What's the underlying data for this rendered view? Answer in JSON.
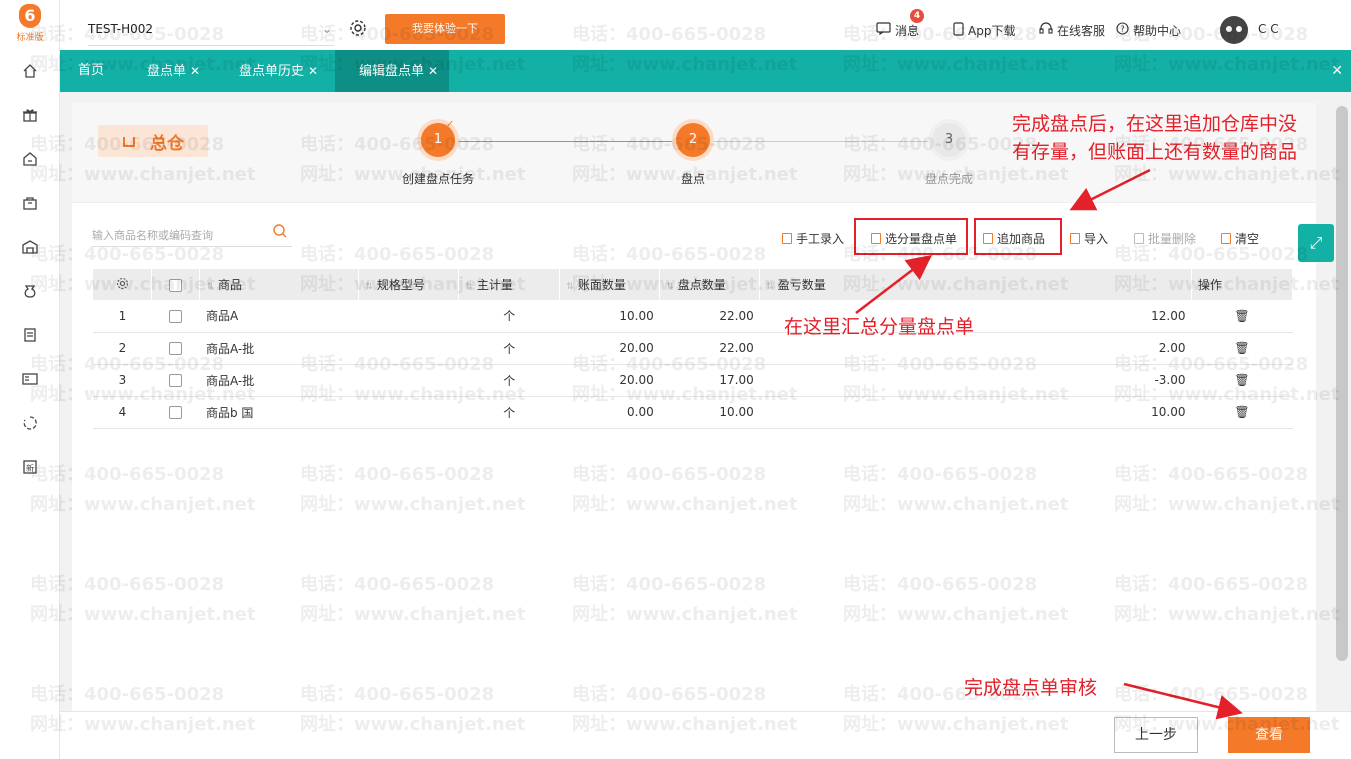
{
  "brand": {
    "logo_char": "6",
    "edition": "标准版",
    "accent": "#f47a2a",
    "teal": "#13b0a5"
  },
  "topbar": {
    "account": "TEST-H002",
    "try_button": "我要体验一下",
    "messages_label": "消息",
    "messages_badge": "4",
    "app_download": "App下载",
    "online_service": "在线客服",
    "help_center": "帮助中心",
    "user_name": "C C"
  },
  "tabs": [
    {
      "label": "首页"
    },
    {
      "label": "盘点单"
    },
    {
      "label": "盘点单历史"
    },
    {
      "label": "编辑盘点单"
    }
  ],
  "warehouse": "总仓",
  "steps": [
    {
      "num": "1",
      "label": "创建盘点任务"
    },
    {
      "num": "2",
      "label": "盘点"
    },
    {
      "num": "3",
      "label": "盘点完成"
    }
  ],
  "search": {
    "placeholder": "输入商品名称或编码查询"
  },
  "toolbar": {
    "manual_entry": "手工录入",
    "select_sub": "选分量盘点单",
    "add_goods": "追加商品",
    "import": "导入",
    "batch_delete": "批量删除",
    "clear": "清空"
  },
  "table": {
    "headers": {
      "goods": "商品",
      "spec": "规格型号",
      "unit": "主计量",
      "book_qty": "账面数量",
      "count_qty": "盘点数量",
      "diff_qty": "盈亏数量",
      "action": "操作"
    },
    "rows": [
      {
        "idx": "1",
        "goods": "商品A",
        "unit": "个",
        "book": "10.00",
        "count": "22.00",
        "diff": "12.00"
      },
      {
        "idx": "2",
        "goods": "商品A-批",
        "unit": "个",
        "book": "20.00",
        "count": "22.00",
        "diff": "2.00"
      },
      {
        "idx": "3",
        "goods": "商品A-批",
        "unit": "个",
        "book": "20.00",
        "count": "17.00",
        "diff": "-3.00"
      },
      {
        "idx": "4",
        "goods": "商品b 国",
        "unit": "个",
        "book": "0.00",
        "count": "10.00",
        "diff": "10.00"
      }
    ]
  },
  "annotations": {
    "top_line1": "完成盘点后，在这里追加仓库中没",
    "top_line2": "有存量，但账面上还有数量的商品",
    "middle": "在这里汇总分量盘点单",
    "bottom": "完成盘点单审核"
  },
  "footer": {
    "prev": "上一步",
    "view": "查看"
  },
  "watermark": {
    "phone": "电话：400-665-0028",
    "site": "网址：www.chanjet.net"
  }
}
